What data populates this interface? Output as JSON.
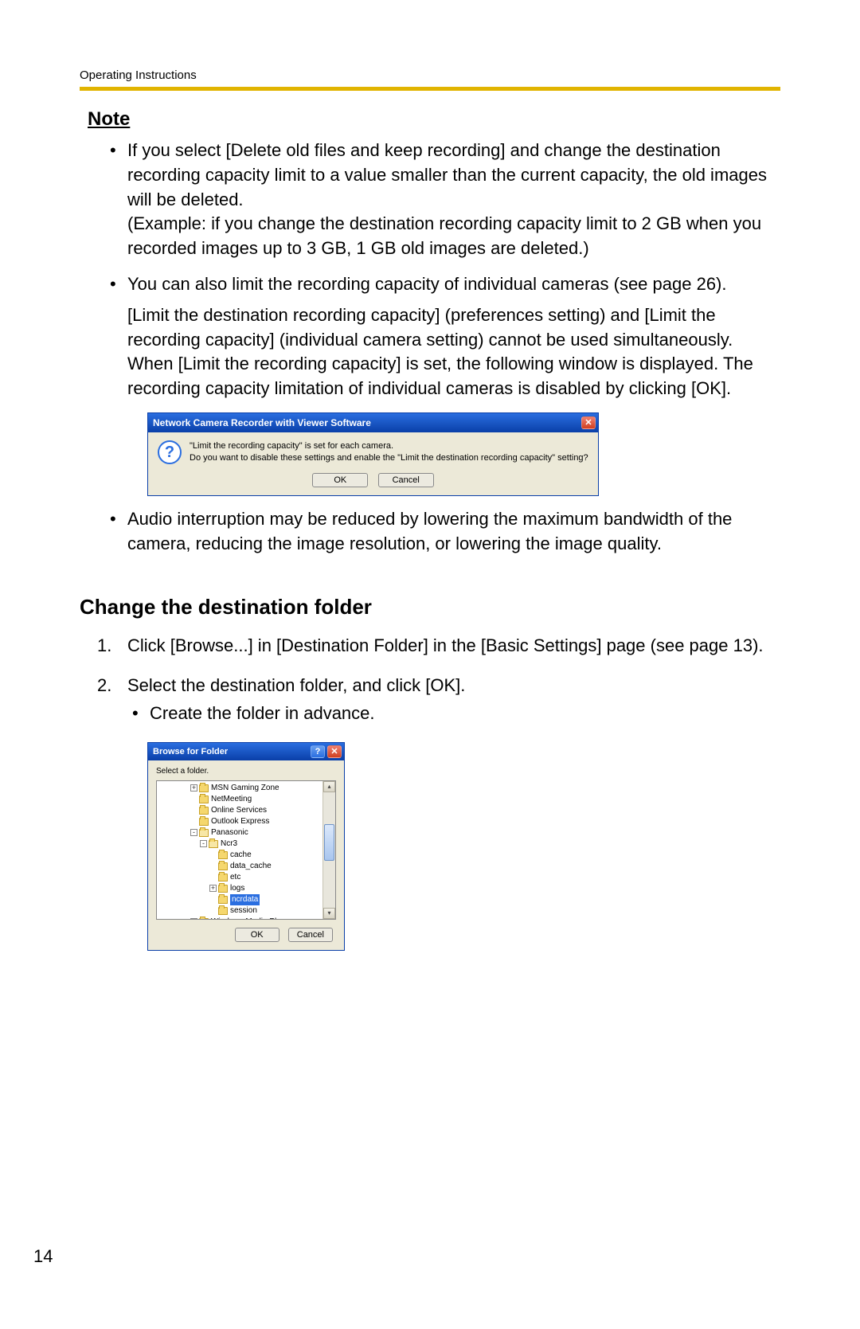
{
  "header": {
    "running": "Operating Instructions"
  },
  "note": {
    "heading": "Note",
    "items": [
      {
        "para1": "If you select [Delete old files and keep recording] and change the destination recording capacity limit to a value smaller than the current capacity, the old images will be deleted.",
        "para2": "(Example: if you change the destination recording capacity limit to 2 GB when you recorded images up to 3 GB, 1 GB old images are deleted.)"
      },
      {
        "para1": "You can also limit the recording capacity of individual cameras (see page 26).",
        "para2": "[Limit the destination recording capacity] (preferences setting) and [Limit the recording capacity] (individual camera setting) cannot be used simultaneously.",
        "para3": "When [Limit the recording capacity] is set, the following window is displayed. The recording capacity limitation of individual cameras is disabled by clicking [OK]."
      },
      {
        "para1": "Audio interruption may be reduced by lowering the maximum bandwidth of the camera, reducing the image resolution, or lowering the image quality."
      }
    ]
  },
  "dialog1": {
    "title": "Network Camera Recorder with Viewer Software",
    "line1": "\"Limit the recording capacity\" is set for each camera.",
    "line2": "Do you want to disable these settings and enable the \"Limit the destination recording capacity\" setting?",
    "ok": "OK",
    "cancel": "Cancel"
  },
  "section": {
    "heading": "Change the destination folder",
    "steps": [
      {
        "text": "Click [Browse...] in [Destination Folder] in the [Basic Settings] page (see page 13)."
      },
      {
        "text": "Select the destination folder, and click [OK].",
        "sub": "Create the folder in advance."
      }
    ]
  },
  "dialog2": {
    "title": "Browse for Folder",
    "prompt": "Select a folder.",
    "tree": [
      {
        "depth": 3,
        "expander": "+",
        "label": "MSN Gaming Zone"
      },
      {
        "depth": 3,
        "expander": "",
        "label": "NetMeeting"
      },
      {
        "depth": 3,
        "expander": "",
        "label": "Online Services"
      },
      {
        "depth": 3,
        "expander": "",
        "label": "Outlook Express"
      },
      {
        "depth": 3,
        "expander": "-",
        "label": "Panasonic",
        "open": true
      },
      {
        "depth": 4,
        "expander": "-",
        "label": "Ncr3",
        "open": true
      },
      {
        "depth": 5,
        "expander": "",
        "label": "cache"
      },
      {
        "depth": 5,
        "expander": "",
        "label": "data_cache"
      },
      {
        "depth": 5,
        "expander": "",
        "label": "etc"
      },
      {
        "depth": 5,
        "expander": "+",
        "label": "logs"
      },
      {
        "depth": 5,
        "expander": "",
        "label": "ncrdata",
        "selected": true
      },
      {
        "depth": 5,
        "expander": "",
        "label": "session"
      },
      {
        "depth": 3,
        "expander": "+",
        "label": "Windows Media Player",
        "open": true
      }
    ],
    "ok": "OK",
    "cancel": "Cancel"
  },
  "pageNumber": "14"
}
